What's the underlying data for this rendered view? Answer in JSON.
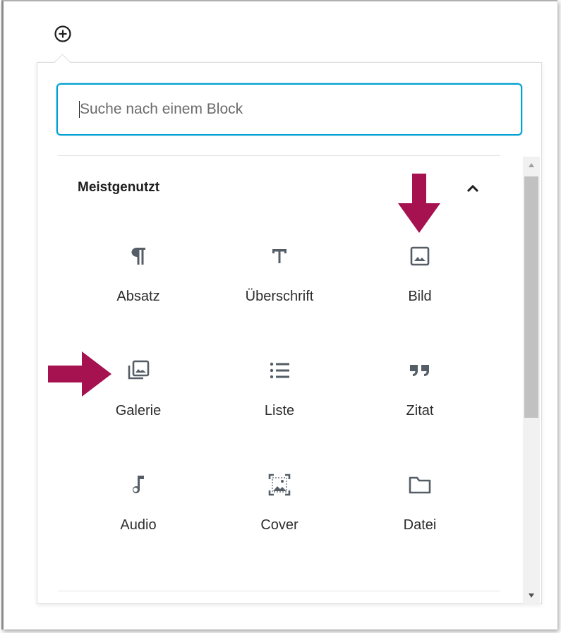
{
  "search": {
    "placeholder": "Suche nach einem Block"
  },
  "panel": {
    "title": "Meistgenutzt"
  },
  "blocks": [
    {
      "label": "Absatz",
      "icon": "paragraph-icon"
    },
    {
      "label": "Überschrift",
      "icon": "heading-icon"
    },
    {
      "label": "Bild",
      "icon": "image-icon"
    },
    {
      "label": "Galerie",
      "icon": "gallery-icon"
    },
    {
      "label": "Liste",
      "icon": "list-icon"
    },
    {
      "label": "Zitat",
      "icon": "quote-icon"
    },
    {
      "label": "Audio",
      "icon": "audio-icon"
    },
    {
      "label": "Cover",
      "icon": "cover-icon"
    },
    {
      "label": "Datei",
      "icon": "file-icon"
    }
  ],
  "colors": {
    "accent_focus": "#00a0d2",
    "annotation_arrow": "#a6114f",
    "icon": "#555d66"
  }
}
